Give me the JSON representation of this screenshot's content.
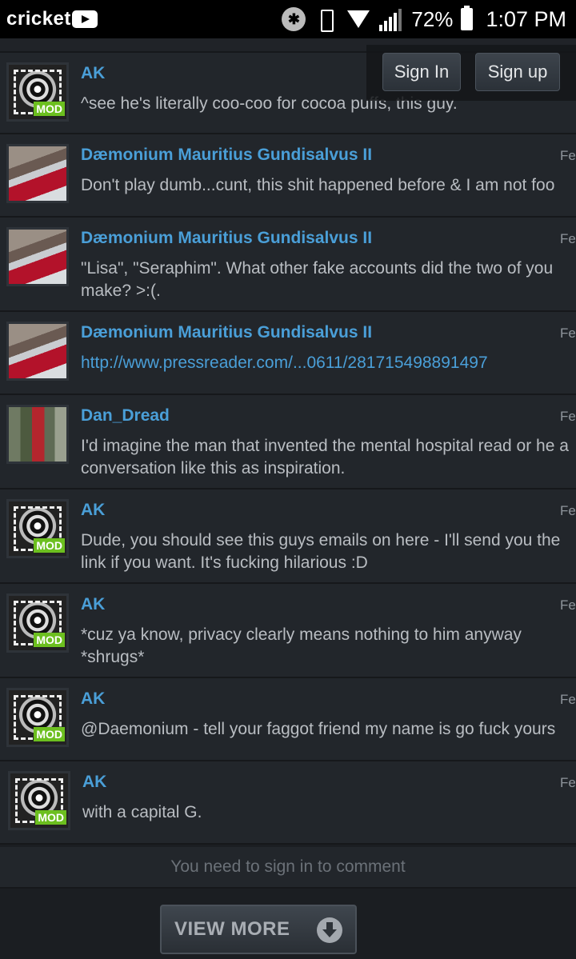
{
  "status": {
    "carrier": "cricket",
    "battery": "72%",
    "time": "1:07 PM",
    "icons": [
      "youtube-icon",
      "bluetooth-icon",
      "vibrate-icon",
      "wifi-icon",
      "signal-icon",
      "battery-icon"
    ]
  },
  "auth": {
    "sign_in": "Sign In",
    "sign_up": "Sign up"
  },
  "comments": [
    {
      "author": "AK",
      "date": "",
      "text": "^see he's literally coo-coo for cocoa puffs, this guy.",
      "mod": true,
      "mod_label": "MOD"
    },
    {
      "author": "Dæmonium Mauritius Gundisalvus II",
      "date": "Fe",
      "text": "Don't play dumb...cunt, this shit happened before & I am not foo",
      "mod": false
    },
    {
      "author": "Dæmonium Mauritius Gundisalvus II",
      "date": "Fe",
      "text": "\"Lisa\", \"Seraphim\". What other fake accounts did the two of you make? >:(.",
      "mod": false
    },
    {
      "author": "Dæmonium Mauritius Gundisalvus II",
      "date": "Fe",
      "text": "http://www.pressreader.com/...0611/281715498891497",
      "mod": false,
      "link": true
    },
    {
      "author": "Dan_Dread",
      "date": "Fe",
      "text": "I'd imagine the man that invented the mental hospital read or he a conversation like this as inspiration.",
      "mod": false
    },
    {
      "author": "AK",
      "date": "Fe",
      "text": "Dude, you should see this guys emails on here - I'll send you the link if you want. It's fucking hilarious :D",
      "mod": true,
      "mod_label": "MOD"
    },
    {
      "author": "AK",
      "date": "Fe",
      "text": "*cuz ya know, privacy clearly means nothing to him anyway *shrugs*",
      "mod": true,
      "mod_label": "MOD"
    },
    {
      "author": "AK",
      "date": "Fe",
      "text": "@Daemonium - tell your faggot friend my name is go fuck yours",
      "mod": true,
      "mod_label": "MOD"
    },
    {
      "author": "AK",
      "date": "Fe",
      "text": "with a capital G.",
      "mod": true,
      "mod_label": "MOD"
    }
  ],
  "signin_note": "You need to sign in to comment",
  "view_more": "VIEW MORE"
}
